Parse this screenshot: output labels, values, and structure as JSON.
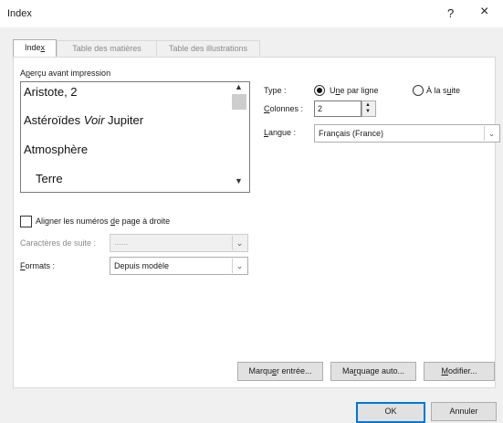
{
  "window": {
    "title": "Index",
    "help": "?",
    "close": "×"
  },
  "tabs": [
    {
      "pre": "Inde",
      "acc": "x",
      "post": ""
    },
    {
      "label": "Table des matières"
    },
    {
      "label": "Table des illustrations"
    }
  ],
  "preview": {
    "label_pre": "A",
    "label_acc": "p",
    "label_post": "erçu avant impression",
    "lines": [
      {
        "text": "Aristote, 2"
      },
      {
        "pre": "Astéroïdes ",
        "italic": "Voir",
        "post": " Jupiter"
      },
      {
        "text": "Atmosphère"
      },
      {
        "text": "Terre"
      }
    ]
  },
  "type_label": "Type :",
  "radio1": {
    "pre": "U",
    "acc": "n",
    "post": "e par ligne"
  },
  "radio2": {
    "pre": "À la s",
    "acc": "u",
    "post": "ite"
  },
  "colonnes": {
    "acc": "C",
    "post": "olonnes :",
    "value": "2"
  },
  "langue": {
    "acc": "L",
    "post": "angue :",
    "value": "Français (France)"
  },
  "align": {
    "pre": "Aligner les numéros ",
    "acc": "d",
    "post": "e page à droite"
  },
  "suite": {
    "label": "Caractères de suite :",
    "value": "......"
  },
  "formats": {
    "acc": "F",
    "post": "ormats :",
    "value": "Depuis modèle"
  },
  "buttons": {
    "marquer": {
      "pre": "Marqu",
      "acc": "e",
      "post": "r entrée..."
    },
    "auto": {
      "pre": "Ma",
      "acc": "r",
      "post": "quage auto..."
    },
    "modifier": {
      "pre": "",
      "acc": "M",
      "post": "odifier..."
    },
    "ok": "OK",
    "annuler": "Annuler"
  },
  "icons": {
    "up": "▲",
    "down": "▼",
    "dd": "⌄"
  }
}
